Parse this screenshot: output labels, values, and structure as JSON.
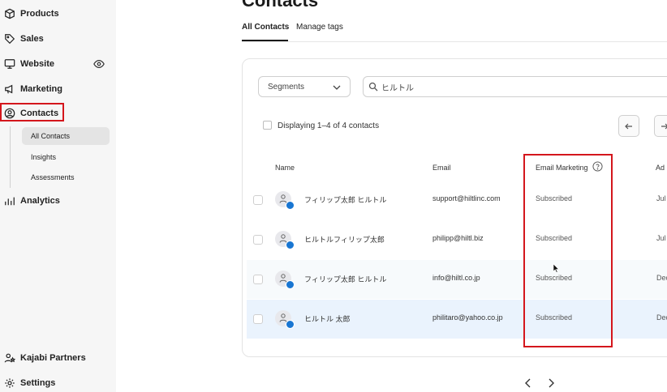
{
  "sidebar": {
    "items": [
      {
        "label": "Products",
        "icon": "box-icon"
      },
      {
        "label": "Sales",
        "icon": "tag-icon"
      },
      {
        "label": "Website",
        "icon": "monitor-icon"
      },
      {
        "label": "Marketing",
        "icon": "megaphone-icon"
      },
      {
        "label": "Contacts",
        "icon": "user-circle-icon"
      },
      {
        "label": "Analytics",
        "icon": "bar-chart-icon"
      }
    ],
    "contacts_sub": [
      {
        "label": "All Contacts"
      },
      {
        "label": "Insights"
      },
      {
        "label": "Assessments"
      }
    ],
    "bottom": [
      {
        "label": "Kajabi Partners",
        "icon": "partners-icon"
      },
      {
        "label": "Settings",
        "icon": "gear-icon"
      }
    ]
  },
  "main": {
    "title": "Contacts",
    "tabs": [
      "All Contacts",
      "Manage tags"
    ],
    "segments_label": "Segments",
    "search_value": "ヒルトル",
    "displaying": "Displaying 1–4 of 4 contacts",
    "columns": [
      "Name",
      "Email",
      "Email Marketing",
      "Ad"
    ],
    "rows": [
      {
        "name": "フィリップ太郎 ヒルトル",
        "email": "support@hiltlinc.com",
        "status": "Subscribed",
        "added": "Jul"
      },
      {
        "name": "ヒルトルフィリップ太郎",
        "email": "philipp@hiltl.biz",
        "status": "Subscribed",
        "added": "Jul"
      },
      {
        "name": "フィリップ太郎 ヒルトル",
        "email": "info@hiltl.co.jp",
        "status": "Subscribed",
        "added": "Dec"
      },
      {
        "name": "ヒルトル 太郎",
        "email": "philitaro@yahoo.co.jp",
        "status": "Subscribed",
        "added": "Dec"
      }
    ]
  },
  "colors": {
    "highlight": "#d4161c",
    "verified": "#1976d2"
  }
}
